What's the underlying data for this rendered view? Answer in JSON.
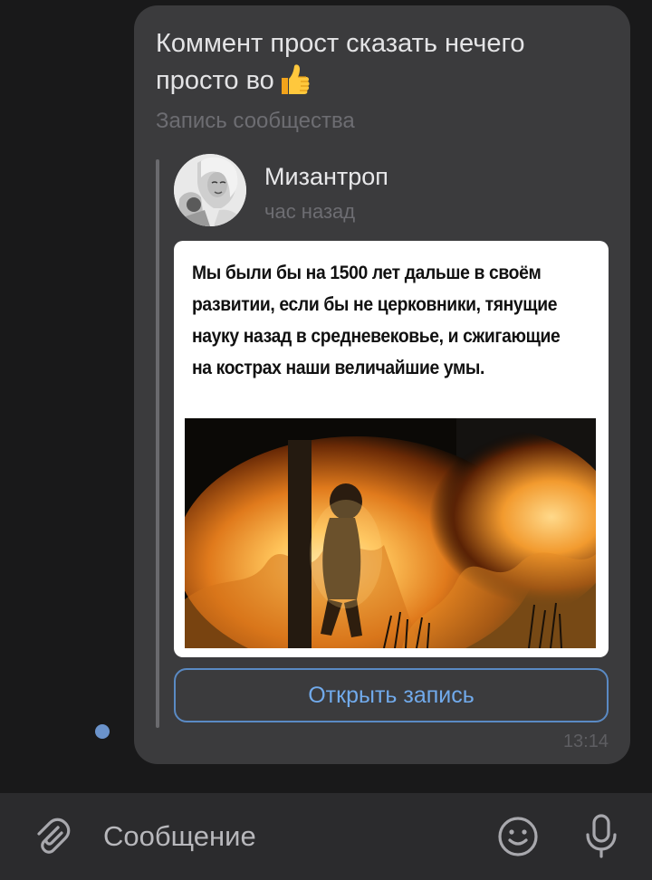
{
  "message": {
    "text": "Коммент прост сказать нечего просто во",
    "emoji": "thumbs-up-emoji",
    "community_label": "Запись сообщества",
    "time": "13:14",
    "read_status": "unread-dot"
  },
  "repost": {
    "author": "Мизантроп",
    "posted": "час назад",
    "caption": "Мы были бы на 1500 лет дальше в своём развитии, если бы не церковники, тянущие науку назад в средневековье, и сжигающие на кострах наши величайшие умы.",
    "open_button": "Открыть запись"
  },
  "composer": {
    "placeholder": "Сообщение",
    "attach_icon": "paperclip-icon",
    "emoji_icon": "smiley-icon",
    "mic_icon": "microphone-icon"
  },
  "colors": {
    "background": "#19191a",
    "bubble": "#3b3b3d",
    "accent": "#71aaeb",
    "composer": "#2b2b2d"
  }
}
